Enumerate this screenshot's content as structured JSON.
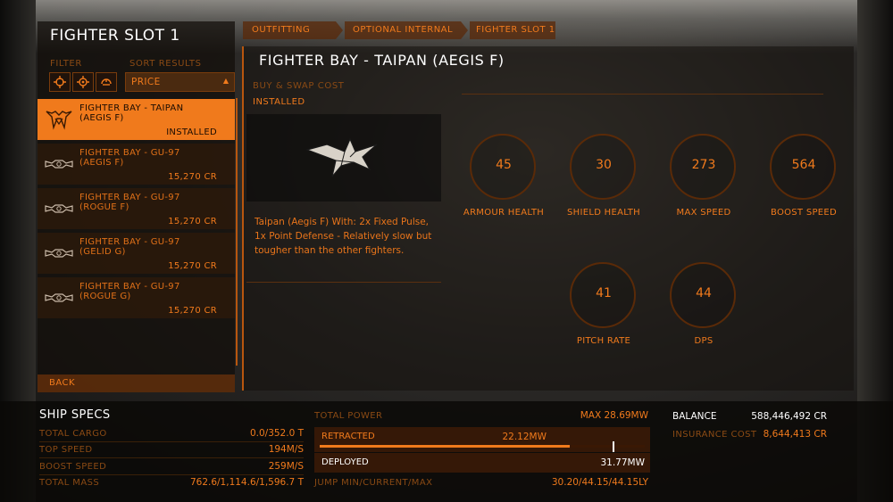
{
  "colors": {
    "accent": "#f07a1c",
    "dim": "#8a4a14",
    "white": "#ffffff"
  },
  "left": {
    "title": "FIGHTER SLOT 1",
    "filter_label": "FILTER",
    "sort_label": "SORT RESULTS",
    "filter_icons": [
      "crosshair-icon",
      "target-icon",
      "gimbal-icon"
    ],
    "sort_value": "PRICE",
    "items": [
      {
        "name": "FIGHTER BAY - TAIPAN (AEGIS F)",
        "price": "INSTALLED",
        "icon": "taipan-ship-icon"
      },
      {
        "name": "FIGHTER BAY - GU-97 (AEGIS F)",
        "price": "15,270 CR",
        "icon": "gu97-ship-icon"
      },
      {
        "name": "FIGHTER BAY - GU-97 (ROGUE F)",
        "price": "15,270 CR",
        "icon": "gu97-ship-icon"
      },
      {
        "name": "FIGHTER BAY - GU-97 (GELID G)",
        "price": "15,270 CR",
        "icon": "gu97-ship-icon"
      },
      {
        "name": "FIGHTER BAY - GU-97 (ROGUE G)",
        "price": "15,270 CR",
        "icon": "gu97-ship-icon"
      }
    ],
    "back": "BACK"
  },
  "breadcrumb": [
    "OUTFITTING",
    "OPTIONAL INTERNAL",
    "FIGHTER SLOT 1"
  ],
  "detail": {
    "title": "FIGHTER BAY - TAIPAN (AEGIS F)",
    "cost_label": "BUY & SWAP COST",
    "status": "INSTALLED",
    "description": "Taipan (Aegis F) With: 2x Fixed Pulse, 1x Point Defense - Relatively slow but tougher than the other fighters.",
    "stats": [
      {
        "value": "45",
        "name": "ARMOUR HEALTH"
      },
      {
        "value": "30",
        "name": "SHIELD HEALTH"
      },
      {
        "value": "273",
        "name": "MAX SPEED"
      },
      {
        "value": "564",
        "name": "BOOST SPEED"
      },
      {
        "value": "41",
        "name": "PITCH RATE"
      },
      {
        "value": "44",
        "name": "DPS"
      }
    ]
  },
  "ship_specs": {
    "title": "SHIP SPECS",
    "rows": [
      {
        "label": "TOTAL CARGO",
        "value": "0.0/352.0 T"
      },
      {
        "label": "TOP SPEED",
        "value": "194M/S"
      },
      {
        "label": "BOOST SPEED",
        "value": "259M/S"
      },
      {
        "label": "TOTAL MASS",
        "value": "762.6/1,114.6/1,596.7 T"
      }
    ]
  },
  "power": {
    "label": "TOTAL POWER",
    "max": "MAX 28.69MW",
    "retracted_label": "RETRACTED",
    "retracted_value": "22.12MW",
    "retracted_fraction": 0.77,
    "deployed_label": "DEPLOYED",
    "deployed_value": "31.77MW",
    "deployed_fraction": 1.0,
    "jump_label": "JUMP MIN/CURRENT/MAX",
    "jump_value": "30.20/44.15/44.15LY"
  },
  "finance": {
    "balance_label": "BALANCE",
    "balance_value": "588,446,492 CR",
    "insurance_label": "INSURANCE COST",
    "insurance_value": "8,644,413 CR"
  }
}
